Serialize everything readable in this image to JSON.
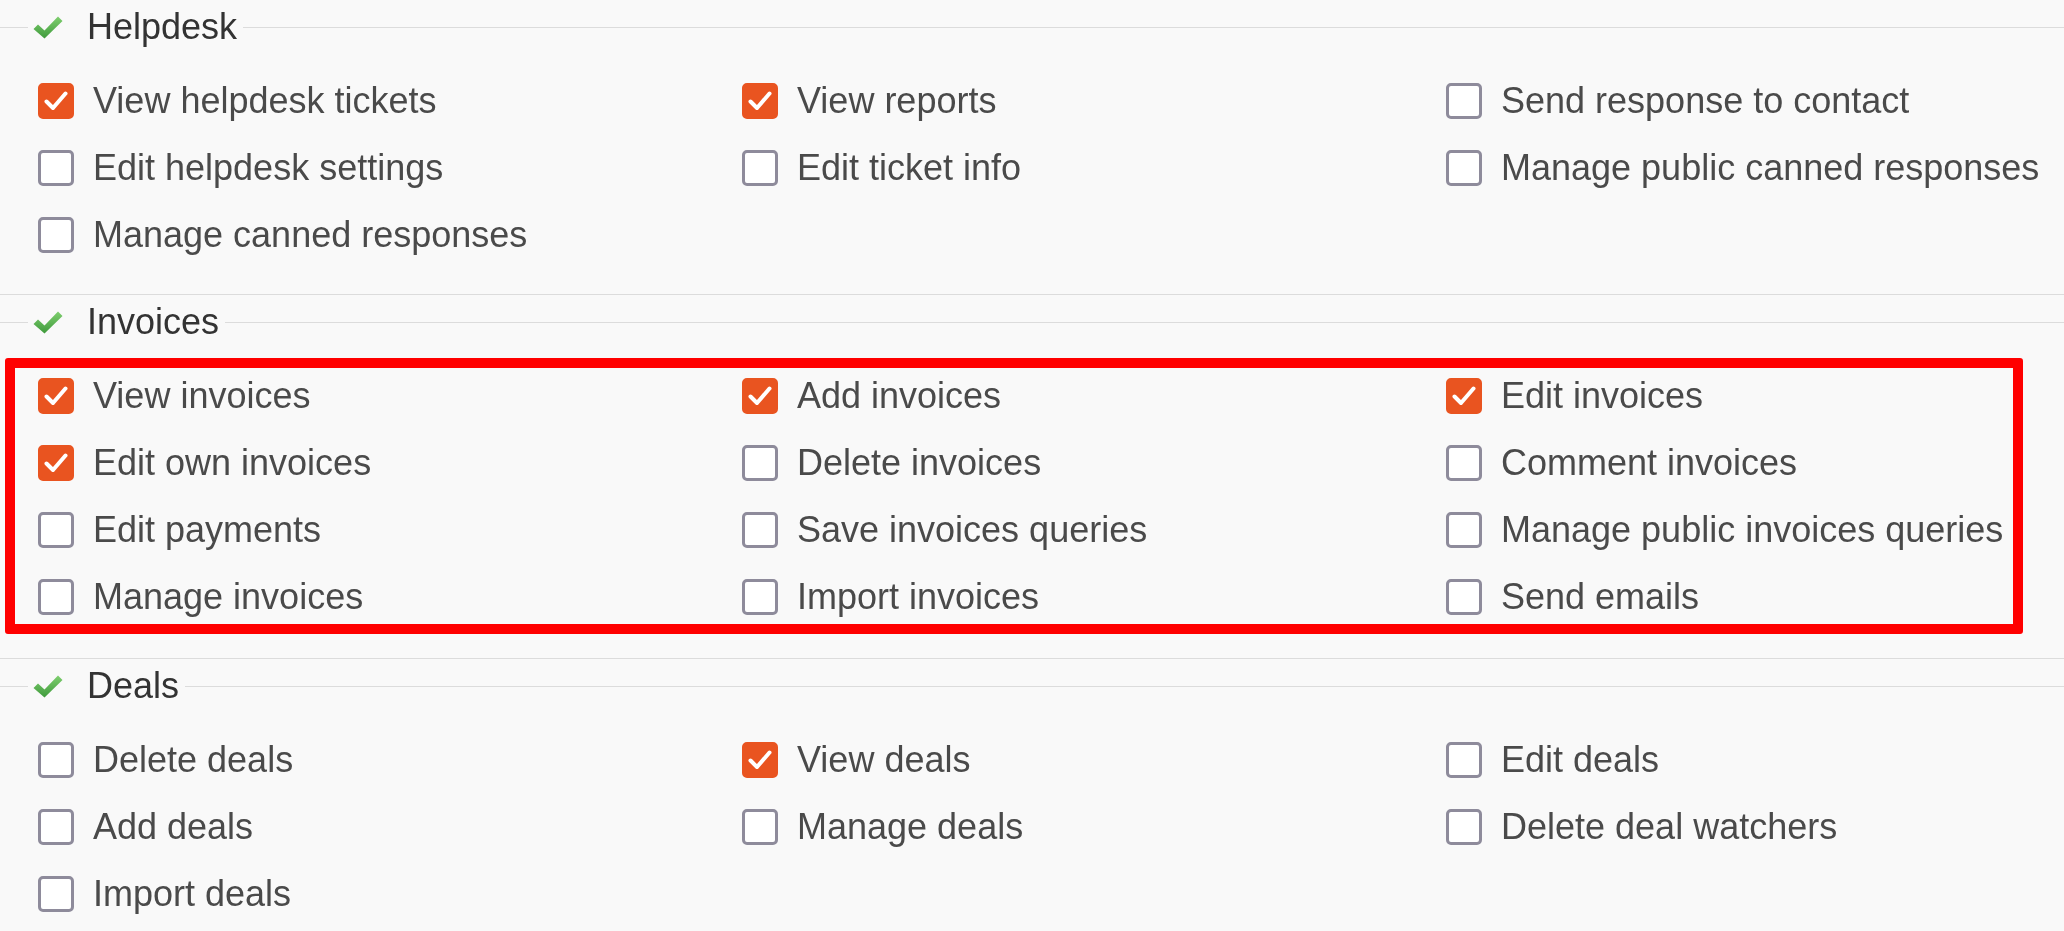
{
  "sections": [
    {
      "title": "Helpdesk",
      "highlighted": false,
      "items": [
        {
          "label": "View helpdesk tickets",
          "checked": true
        },
        {
          "label": "View reports",
          "checked": true
        },
        {
          "label": "Send response to contact",
          "checked": false
        },
        {
          "label": "Edit helpdesk settings",
          "checked": false
        },
        {
          "label": "Edit ticket info",
          "checked": false
        },
        {
          "label": "Manage public canned responses",
          "checked": false
        },
        {
          "label": "Manage canned responses",
          "checked": false
        }
      ]
    },
    {
      "title": "Invoices",
      "highlighted": true,
      "items": [
        {
          "label": "View invoices",
          "checked": true
        },
        {
          "label": "Add invoices",
          "checked": true
        },
        {
          "label": "Edit invoices",
          "checked": true
        },
        {
          "label": "Edit own invoices",
          "checked": true
        },
        {
          "label": "Delete invoices",
          "checked": false
        },
        {
          "label": "Comment invoices",
          "checked": false
        },
        {
          "label": "Edit payments",
          "checked": false
        },
        {
          "label": "Save invoices queries",
          "checked": false
        },
        {
          "label": "Manage public invoices queries",
          "checked": false
        },
        {
          "label": "Manage invoices",
          "checked": false
        },
        {
          "label": "Import invoices",
          "checked": false
        },
        {
          "label": "Send emails",
          "checked": false
        }
      ]
    },
    {
      "title": "Deals",
      "highlighted": false,
      "items": [
        {
          "label": "Delete deals",
          "checked": false
        },
        {
          "label": "View deals",
          "checked": true
        },
        {
          "label": "Edit deals",
          "checked": false
        },
        {
          "label": "Add deals",
          "checked": false
        },
        {
          "label": "Manage deals",
          "checked": false
        },
        {
          "label": "Delete deal watchers",
          "checked": false
        },
        {
          "label": "Import deals",
          "checked": false
        }
      ]
    }
  ]
}
